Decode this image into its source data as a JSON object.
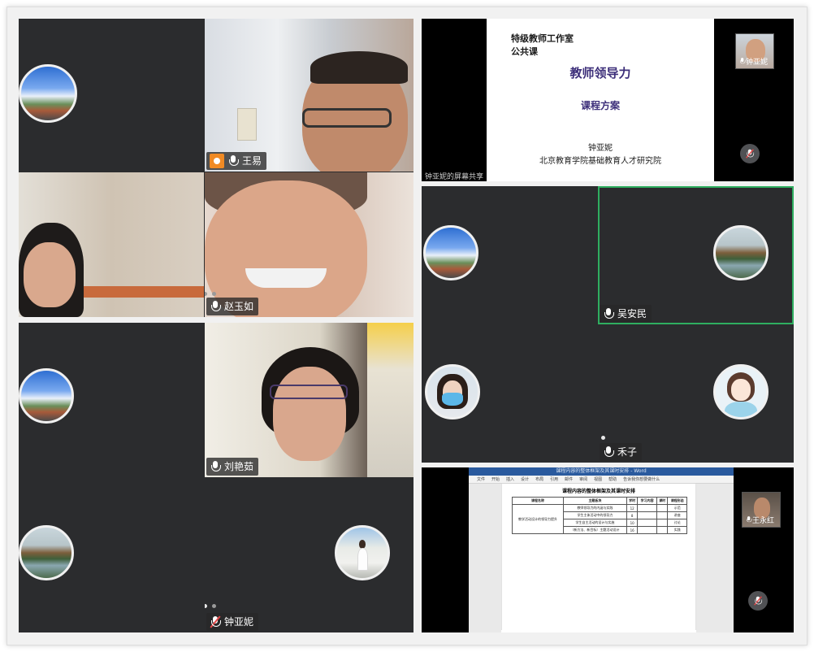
{
  "participants": {
    "wang_yi": "王易",
    "zhao_yuru": "赵玉如",
    "liu_yanru": "刘艳茹",
    "zhong_yani": "钟亚妮",
    "wu_anmin": "吴安民",
    "he_zi": "禾子",
    "wang_yonghong": "王永红",
    "zhong_yani_thumb": "钟亚妮"
  },
  "slide": {
    "line1": "特级教师工作室",
    "line2": "公共课",
    "title": "教师领导力",
    "subtitle": "课程方案",
    "author": "钟亚妮",
    "org": "北京教育学院基础教育人才研究院",
    "share_label": "钟亚妮的屏幕共享"
  },
  "doc": {
    "window_title": "课程内容的整体框架及其课时安排 - Word",
    "ribbon": [
      "文件",
      "开始",
      "插入",
      "设计",
      "布局",
      "引用",
      "邮件",
      "审阅",
      "视图",
      "帮助",
      "告诉我你想要做什么"
    ],
    "heading": "课程内容的整体框架及其课时安排",
    "headers": [
      "课程名称",
      "主题板块",
      "学时",
      "学习内容",
      "课时",
      "课程形态"
    ],
    "course": "教学活动设计的领导力提升",
    "rows": [
      [
        "教师领导力的内涵与实践",
        "12",
        "示范"
      ],
      [
        "学生主体活动中的领导力",
        "8",
        "讲座"
      ],
      [
        "学生自主活动的设计与实施",
        "10",
        "讨论"
      ],
      [
        "（新方法、新目标）主题活动设计",
        "16",
        "实践"
      ]
    ]
  },
  "colors": {
    "tile_bg": "#2b2c2e",
    "active_border": "#2fae60",
    "host_badge": "#f08a24",
    "slide_title": "#3d2f7a"
  }
}
